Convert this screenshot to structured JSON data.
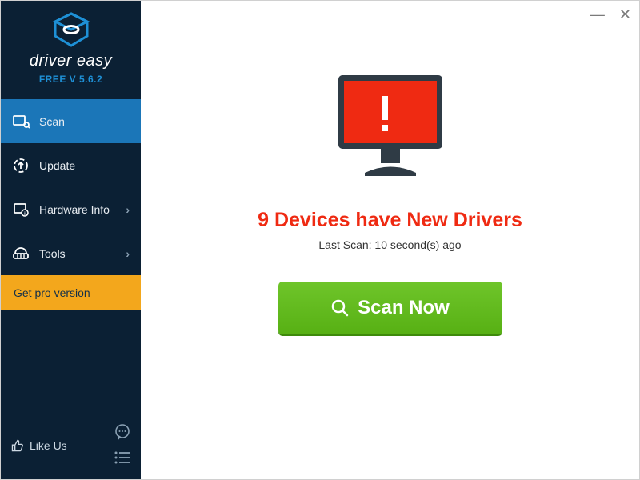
{
  "brand": {
    "name": "driver easy",
    "version_label": "FREE V 5.6.2"
  },
  "sidebar": {
    "items": [
      {
        "label": "Scan"
      },
      {
        "label": "Update"
      },
      {
        "label": "Hardware Info"
      },
      {
        "label": "Tools"
      }
    ],
    "pro_label": "Get pro version",
    "likeus_label": "Like Us"
  },
  "main": {
    "headline": "9 Devices have New Drivers",
    "subline": "Last Scan: 10 second(s) ago",
    "scan_button": "Scan Now"
  },
  "colors": {
    "sidebar_bg": "#0b2034",
    "active_bg": "#1b76b8",
    "pro_bg": "#f3a71c",
    "alert_red": "#ef2a12",
    "scan_green": "#6fc52a"
  }
}
